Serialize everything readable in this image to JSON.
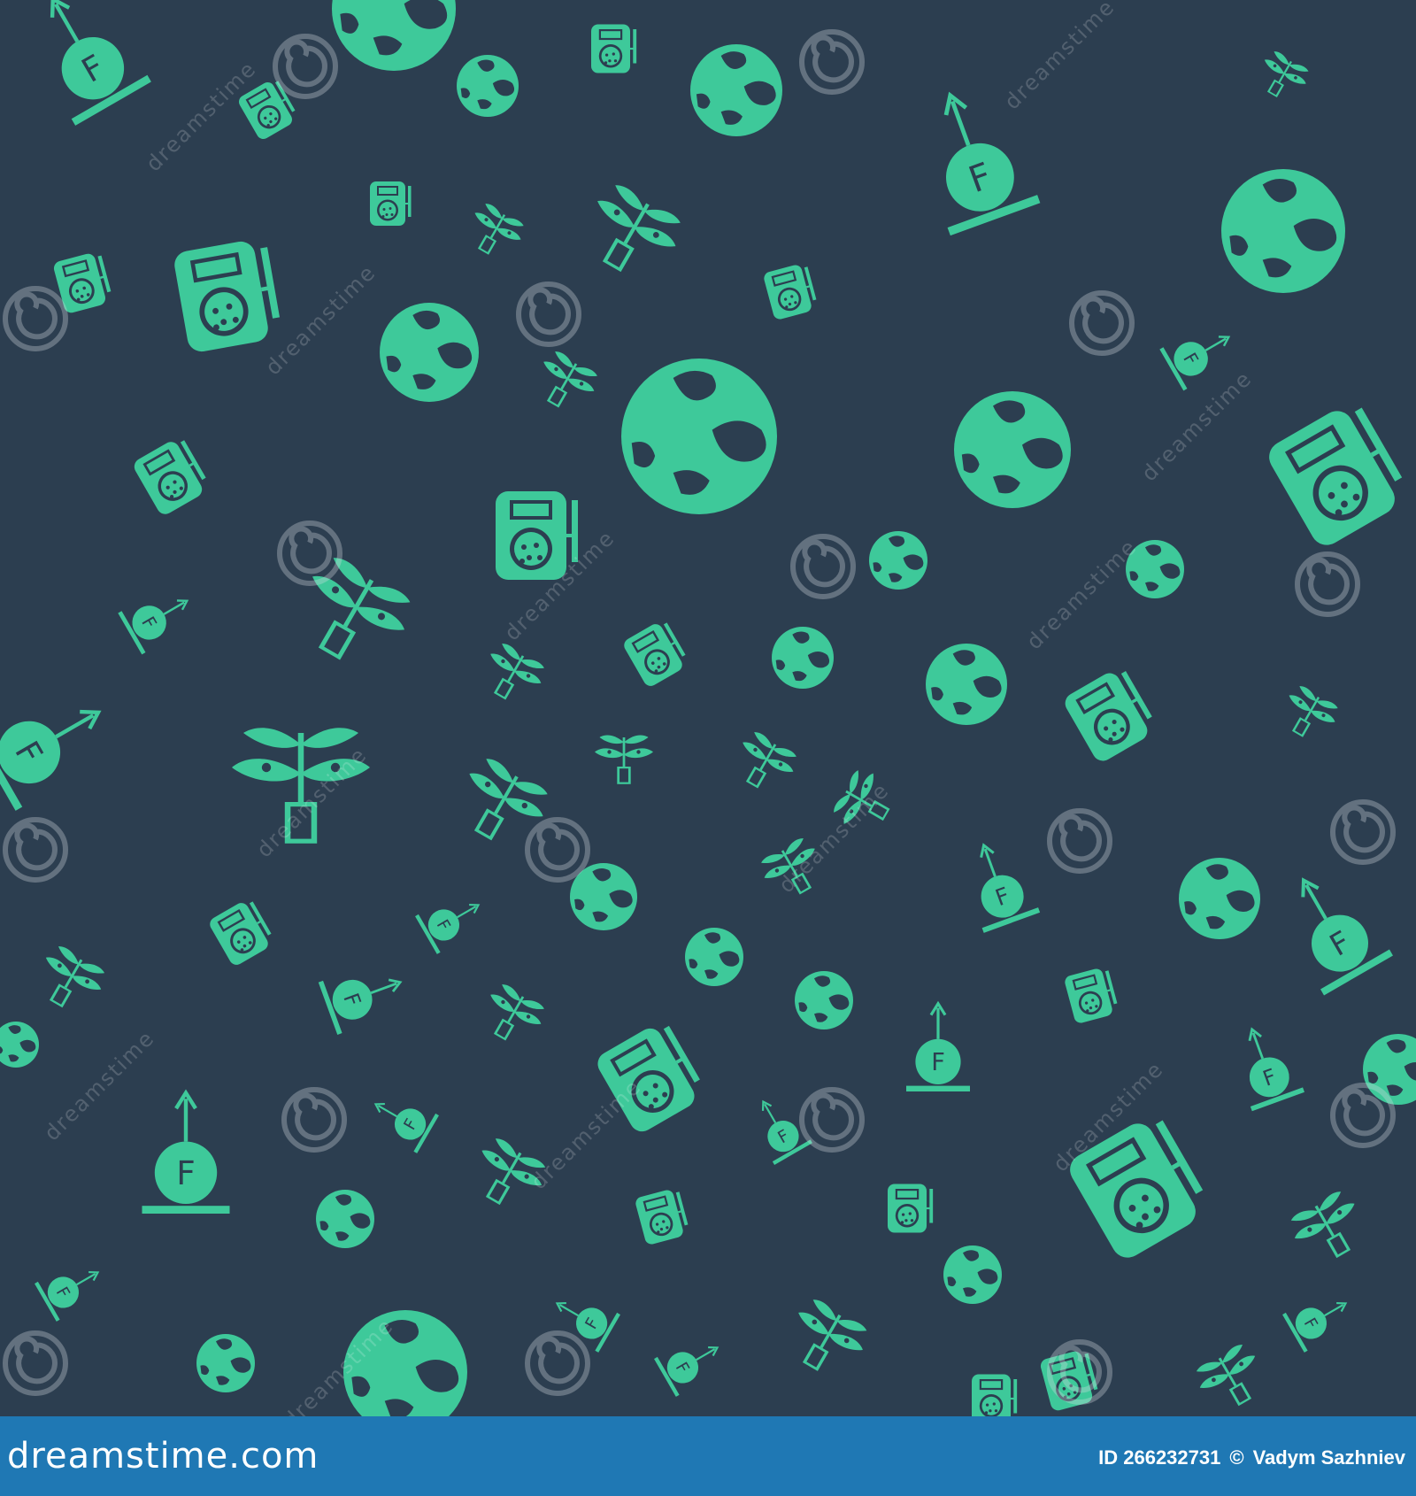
{
  "image": {
    "background_color": "#2c3e50",
    "icon_color": "#3ec99a",
    "watermark_color": "rgba(255,255,255,0.30)",
    "icon_kinds": [
      "planet-globe-icon",
      "force-f-arrow-icon",
      "plant-sprout-icon",
      "seed-bag-icon"
    ],
    "repeated_label": "F"
  },
  "watermark": {
    "text": "dreamstime",
    "logo": "dreamstime-spiral-logo"
  },
  "footer": {
    "brand": "dreamstime.com",
    "id_label": "ID 266232731",
    "copyright_symbol": "©",
    "author": "Vadym Sazhniev",
    "background_color": "#1f78b4"
  }
}
